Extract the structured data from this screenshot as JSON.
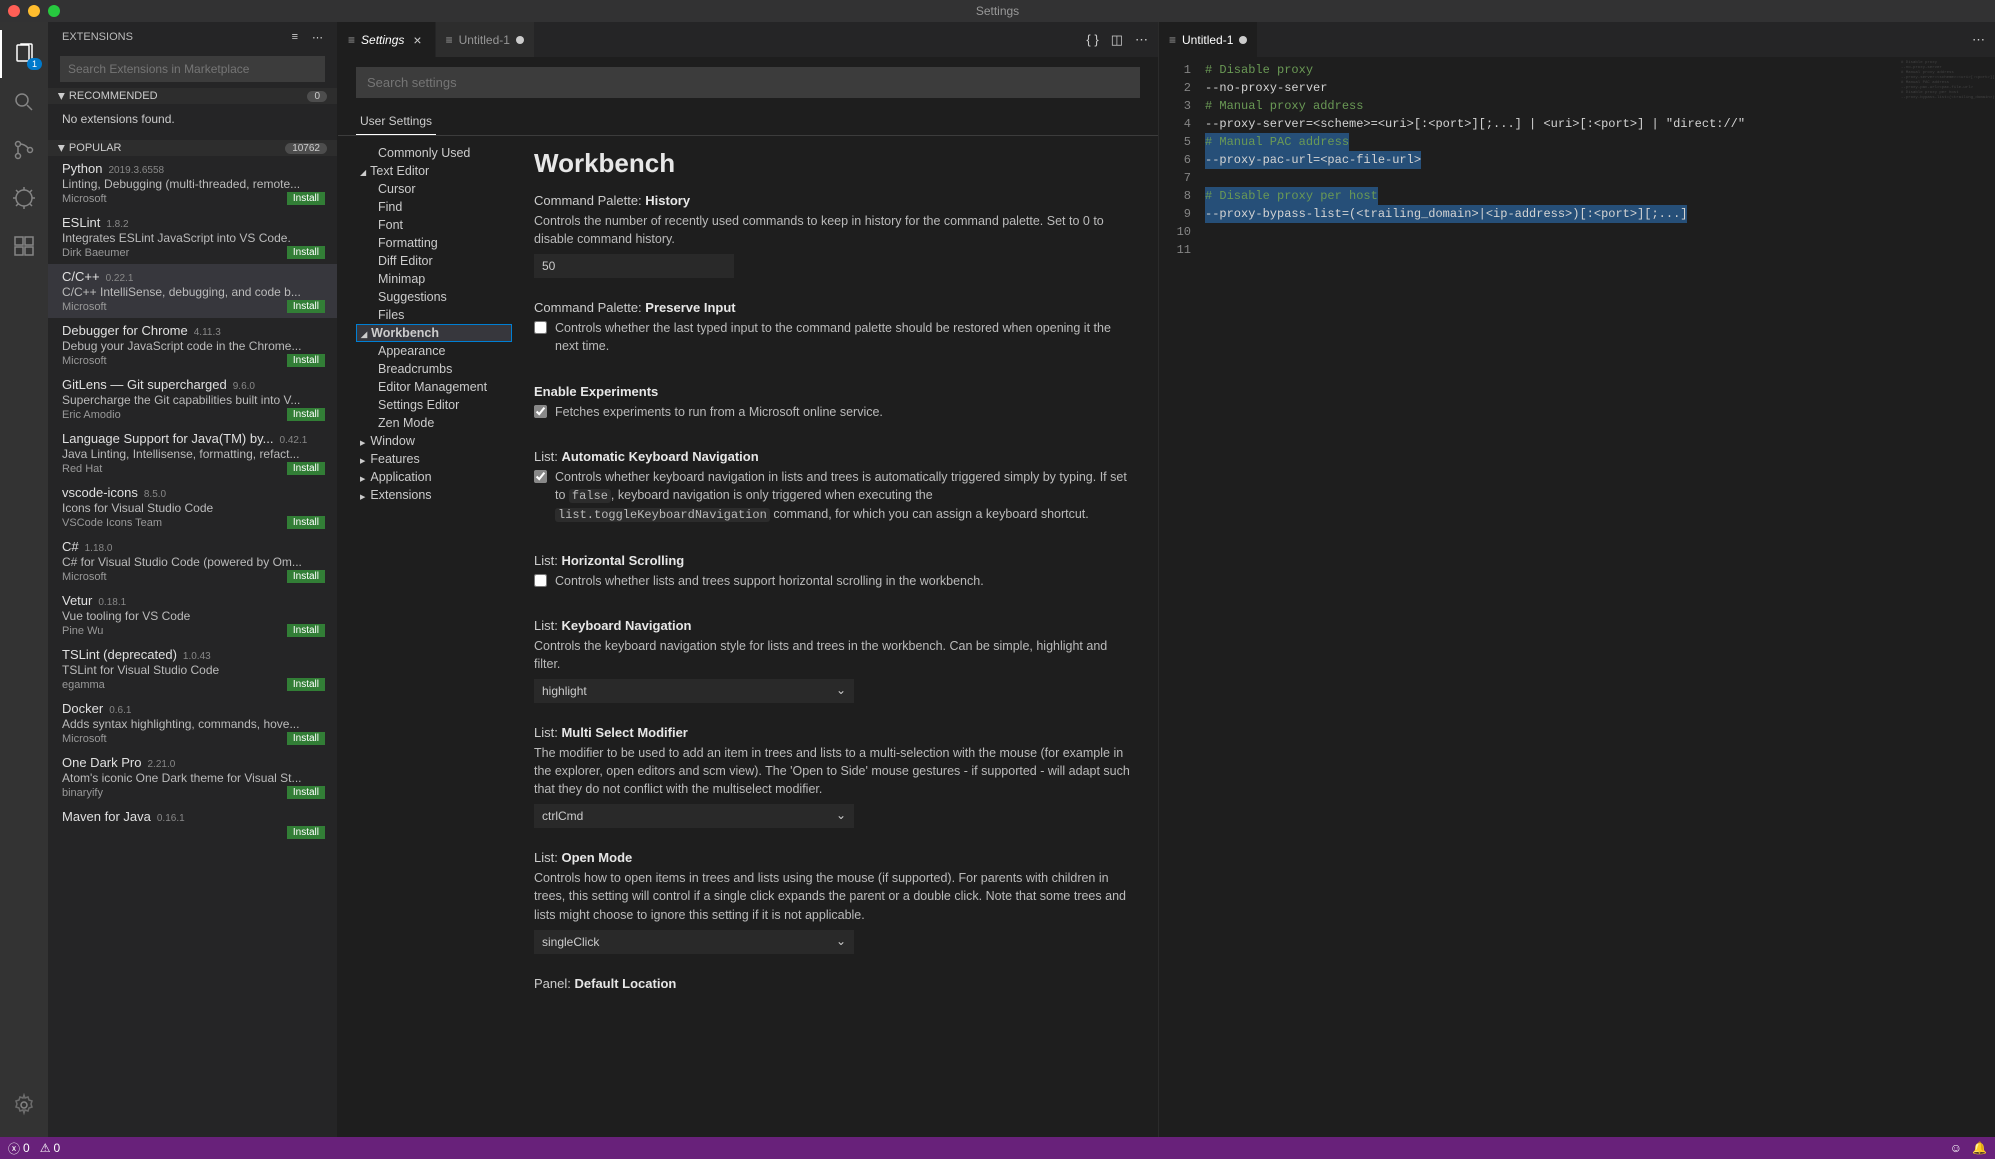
{
  "window": {
    "title": "Settings"
  },
  "sidebar": {
    "title": "EXTENSIONS",
    "search_placeholder": "Search Extensions in Marketplace",
    "recommended": {
      "label": "RECOMMENDED",
      "count": "0",
      "empty_msg": "No extensions found."
    },
    "popular": {
      "label": "POPULAR",
      "count": "10762"
    },
    "extensions": [
      {
        "name": "Python",
        "ver": "2019.3.6558",
        "desc": "Linting, Debugging (multi-threaded, remote...",
        "pub": "Microsoft",
        "install": "Install"
      },
      {
        "name": "ESLint",
        "ver": "1.8.2",
        "desc": "Integrates ESLint JavaScript into VS Code.",
        "pub": "Dirk Baeumer",
        "install": "Install"
      },
      {
        "name": "C/C++",
        "ver": "0.22.1",
        "desc": "C/C++ IntelliSense, debugging, and code b...",
        "pub": "Microsoft",
        "install": "Install"
      },
      {
        "name": "Debugger for Chrome",
        "ver": "4.11.3",
        "desc": "Debug your JavaScript code in the Chrome...",
        "pub": "Microsoft",
        "install": "Install"
      },
      {
        "name": "GitLens — Git supercharged",
        "ver": "9.6.0",
        "desc": "Supercharge the Git capabilities built into V...",
        "pub": "Eric Amodio",
        "install": "Install"
      },
      {
        "name": "Language Support for Java(TM) by...",
        "ver": "0.42.1",
        "desc": "Java Linting, Intellisense, formatting, refact...",
        "pub": "Red Hat",
        "install": "Install"
      },
      {
        "name": "vscode-icons",
        "ver": "8.5.0",
        "desc": "Icons for Visual Studio Code",
        "pub": "VSCode Icons Team",
        "install": "Install"
      },
      {
        "name": "C#",
        "ver": "1.18.0",
        "desc": "C# for Visual Studio Code (powered by Om...",
        "pub": "Microsoft",
        "install": "Install"
      },
      {
        "name": "Vetur",
        "ver": "0.18.1",
        "desc": "Vue tooling for VS Code",
        "pub": "Pine Wu",
        "install": "Install"
      },
      {
        "name": "TSLint (deprecated)",
        "ver": "1.0.43",
        "desc": "TSLint for Visual Studio Code",
        "pub": "egamma",
        "install": "Install"
      },
      {
        "name": "Docker",
        "ver": "0.6.1",
        "desc": "Adds syntax highlighting, commands, hove...",
        "pub": "Microsoft",
        "install": "Install"
      },
      {
        "name": "One Dark Pro",
        "ver": "2.21.0",
        "desc": "Atom's iconic One Dark theme for Visual St...",
        "pub": "binaryify",
        "install": "Install"
      },
      {
        "name": "Maven for Java",
        "ver": "0.16.1",
        "desc": "",
        "pub": "",
        "install": "Install"
      }
    ]
  },
  "tabs_left": [
    {
      "label": "Settings",
      "active": true,
      "close": true
    },
    {
      "label": "Untitled-1",
      "active": false,
      "dirty": true
    }
  ],
  "tabs_right": [
    {
      "label": "Untitled-1",
      "active": true,
      "dirty": true
    }
  ],
  "settings": {
    "search_placeholder": "Search settings",
    "tab": "User Settings",
    "nav": [
      {
        "l": "Commonly Used",
        "lvl": 1
      },
      {
        "l": "Text Editor",
        "lvl": 0,
        "open": true
      },
      {
        "l": "Cursor",
        "lvl": 1
      },
      {
        "l": "Find",
        "lvl": 1
      },
      {
        "l": "Font",
        "lvl": 1
      },
      {
        "l": "Formatting",
        "lvl": 1
      },
      {
        "l": "Diff Editor",
        "lvl": 1
      },
      {
        "l": "Minimap",
        "lvl": 1
      },
      {
        "l": "Suggestions",
        "lvl": 1
      },
      {
        "l": "Files",
        "lvl": 1
      },
      {
        "l": "Workbench",
        "lvl": 0,
        "open": true,
        "sel": true
      },
      {
        "l": "Appearance",
        "lvl": 1
      },
      {
        "l": "Breadcrumbs",
        "lvl": 1
      },
      {
        "l": "Editor Management",
        "lvl": 1
      },
      {
        "l": "Settings Editor",
        "lvl": 1
      },
      {
        "l": "Zen Mode",
        "lvl": 1
      },
      {
        "l": "Window",
        "lvl": 0,
        "open": false
      },
      {
        "l": "Features",
        "lvl": 0,
        "open": false
      },
      {
        "l": "Application",
        "lvl": 0,
        "open": false
      },
      {
        "l": "Extensions",
        "lvl": 0,
        "open": false
      }
    ],
    "heading": "Workbench",
    "items": {
      "history": {
        "title_a": "Command Palette:",
        "title_b": "History",
        "desc": "Controls the number of recently used commands to keep in history for the command palette. Set to 0 to disable command history.",
        "value": "50"
      },
      "preserve": {
        "title_a": "Command Palette:",
        "title_b": "Preserve Input",
        "desc": "Controls whether the last typed input to the command palette should be restored when opening it the next time.",
        "checked": false
      },
      "experiments": {
        "title_b": "Enable Experiments",
        "desc": "Fetches experiments to run from a Microsoft online service.",
        "checked": true
      },
      "autonav": {
        "title_a": "List:",
        "title_b": "Automatic Keyboard Navigation",
        "desc_a": "Controls whether keyboard navigation in lists and trees is automatically triggered simply by typing. If set to ",
        "code1": "false",
        "desc_b": ", keyboard navigation is only triggered when executing the ",
        "code2": "list.toggleKeyboardNavigation",
        "desc_c": " command, for which you can assign a keyboard shortcut.",
        "checked": true
      },
      "hscroll": {
        "title_a": "List:",
        "title_b": "Horizontal Scrolling",
        "desc": "Controls whether lists and trees support horizontal scrolling in the workbench.",
        "checked": false
      },
      "keynav": {
        "title_a": "List:",
        "title_b": "Keyboard Navigation",
        "desc": "Controls the keyboard navigation style for lists and trees in the workbench. Can be simple, highlight and filter.",
        "value": "highlight"
      },
      "multisel": {
        "title_a": "List:",
        "title_b": "Multi Select Modifier",
        "desc": "The modifier to be used to add an item in trees and lists to a multi-selection with the mouse (for example in the explorer, open editors and scm view). The 'Open to Side' mouse gestures - if supported - will adapt such that they do not conflict with the multiselect modifier.",
        "value": "ctrlCmd"
      },
      "openmode": {
        "title_a": "List:",
        "title_b": "Open Mode",
        "desc": "Controls how to open items in trees and lists using the mouse (if supported). For parents with children in trees, this setting will control if a single click expands the parent or a double click. Note that some trees and lists might choose to ignore this setting if it is not applicable.",
        "value": "singleClick"
      },
      "panel": {
        "title_a": "Panel:",
        "title_b": "Default Location"
      }
    }
  },
  "editor": {
    "lines": [
      {
        "n": 1,
        "t": "# Disable proxy",
        "c": "c-comment"
      },
      {
        "n": 2,
        "t": "--no-proxy-server",
        "c": "c-var"
      },
      {
        "n": 3,
        "t": "",
        "c": ""
      },
      {
        "n": 4,
        "t": "# Manual proxy address",
        "c": "c-comment"
      },
      {
        "n": 5,
        "t": "--proxy-server=<scheme>=<uri>[:<port>][;...] | <uri>[:<port>] | \"direct://\"",
        "c": "c-var"
      },
      {
        "n": 6,
        "t": "",
        "c": ""
      },
      {
        "n": 7,
        "t": "# Manual PAC address",
        "c": "c-comment",
        "hl": true
      },
      {
        "n": 8,
        "t": "--proxy-pac-url=<pac-file-url>",
        "c": "c-var",
        "hl": true
      },
      {
        "n": 9,
        "t": "",
        "c": "",
        "hl": true
      },
      {
        "n": 10,
        "t": "# Disable proxy per host",
        "c": "c-comment",
        "hl": true
      },
      {
        "n": 11,
        "t": "--proxy-bypass-list=(<trailing_domain>|<ip-address>)[:<port>][;...]",
        "c": "c-var",
        "hl": true
      }
    ]
  },
  "status": {
    "errors": "0",
    "warnings": "0"
  }
}
